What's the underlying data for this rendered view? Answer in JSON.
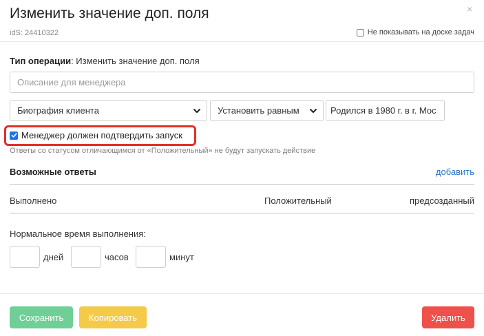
{
  "modal": {
    "title": "Изменить значение доп. поля",
    "close_icon": "×",
    "ids_text": "idS: 24410322",
    "hide_on_board": {
      "label": "Не показывать на доске задач",
      "checked": false
    }
  },
  "operation": {
    "type_label": "Тип операции",
    "type_value": ": Изменить значение доп. поля",
    "description_placeholder": "Описание для менеджера",
    "field_select": "Биография клиента",
    "operator_select": "Установить равным",
    "value": "Родился в 1980 г. в г. Мос"
  },
  "confirm": {
    "label": "Менеджер должен подтвердить запуск",
    "checked": true,
    "hint": "Ответы со статусом отличающимся от «Положительный» не будут запускать действие",
    "highlight_color": "#e0302a"
  },
  "answers": {
    "title": "Возможные ответы",
    "add_label": "добавить",
    "rows": [
      {
        "name": "Выполнено",
        "status": "Положительный",
        "type": "предсозданный"
      }
    ]
  },
  "timing": {
    "label": "Нормальное время выполнения:",
    "days_label": "дней",
    "hours_label": "часов",
    "minutes_label": "минут"
  },
  "footer": {
    "save_label": "Сохранить",
    "copy_label": "Копировать",
    "delete_label": "Удалить"
  },
  "colors": {
    "save": "#6fcf97",
    "copy": "#f5c94a",
    "delete": "#f0504a",
    "link": "#2c73c9",
    "checkbox": "#1a73e8"
  }
}
